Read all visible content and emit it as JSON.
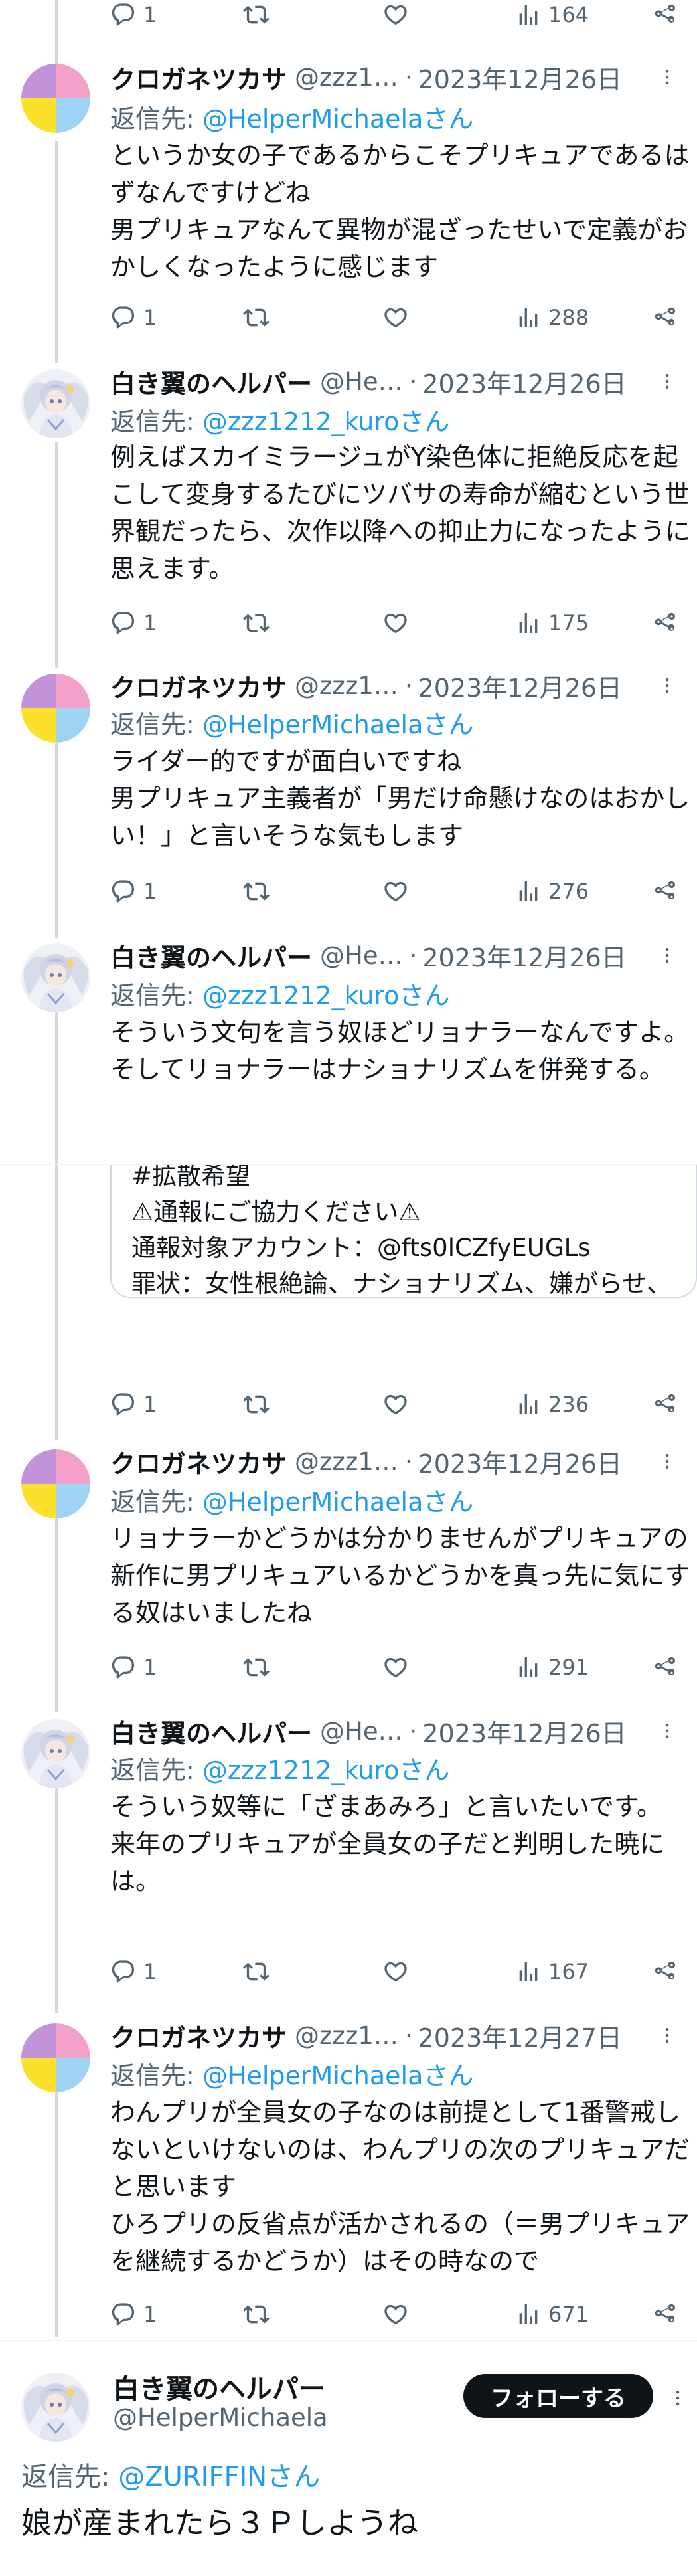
{
  "icons": {
    "reply": "reply-icon",
    "retweet": "retweet-icon",
    "like": "heart-icon",
    "views": "views-icon",
    "share": "share-icon",
    "more": "more-icon"
  },
  "colors": {
    "link": "#1d9bf0",
    "secondary": "#536471",
    "text": "#0f1419",
    "thread_line": "#cfd9de",
    "follow_button": "#0f1419"
  },
  "top_actions": {
    "reply_count": "1",
    "retweet_count": "",
    "like_count": "",
    "view_count": "164"
  },
  "tweets": [
    {
      "name": "クロガネツカサ",
      "handle": "@zzz1…",
      "dot": "·",
      "date": "2023年12月26日",
      "reply_prefix": "返信先:",
      "reply_target": "@HelperMichaelaさん",
      "text": "というか女の子であるからこそプリキュアであるはずなんですけどね\n男プリキュアなんて異物が混ざったせいで定義がおかしくなったように感じます",
      "reply_count": "1",
      "view_count": "288"
    },
    {
      "name": "白き翼のヘルパー",
      "handle": "@He…",
      "dot": "·",
      "date": "2023年12月26日",
      "reply_prefix": "返信先:",
      "reply_target": "@zzz1212_kuroさん",
      "text": "例えばスカイミラージュがY染色体に拒絶反応を起こして変身するたびにツバサの寿命が縮むという世界観だったら、次作以降への抑止力になったように思えます。",
      "reply_count": "1",
      "view_count": "175"
    },
    {
      "name": "クロガネツカサ",
      "handle": "@zzz1…",
      "dot": "·",
      "date": "2023年12月26日",
      "reply_prefix": "返信先:",
      "reply_target": "@HelperMichaelaさん",
      "text": "ライダー的ですが面白いですね\n男プリキュア主義者が「男だけ命懸けなのはおかしい！」と言いそうな気もします",
      "reply_count": "1",
      "view_count": "276"
    },
    {
      "name": "白き翼のヘルパー",
      "handle": "@He…",
      "dot": "·",
      "date": "2023年12月26日",
      "reply_prefix": "返信先:",
      "reply_target": "@zzz1212_kuroさん",
      "text": "そういう文句を言う奴ほどリョナラーなんですよ。\nそしてリョナラーはナショナリズムを併発する。",
      "card_text": "#拡散希望\n⚠通報にご協力ください⚠\n通報対象アカウント：@fts0lCZfyEUGLs\n罪状：女性根絶論、ナショナリズム、嫌がらせ、マーダー教唆、マーダー願望、女…",
      "reply_count": "1",
      "view_count": "236"
    },
    {
      "name": "クロガネツカサ",
      "handle": "@zzz1…",
      "dot": "·",
      "date": "2023年12月26日",
      "reply_prefix": "返信先:",
      "reply_target": "@HelperMichaelaさん",
      "text": "リョナラーかどうかは分かりませんがプリキュアの新作に男プリキュアいるかどうかを真っ先に気にする奴はいましたね",
      "reply_count": "1",
      "view_count": "291"
    },
    {
      "name": "白き翼のヘルパー",
      "handle": "@He…",
      "dot": "·",
      "date": "2023年12月26日",
      "reply_prefix": "返信先:",
      "reply_target": "@zzz1212_kuroさん",
      "text": "そういう奴等に「ざまあみろ」と言いたいです。\n来年のプリキュアが全員女の子だと判明した暁には。",
      "reply_count": "1",
      "view_count": "167"
    },
    {
      "name": "クロガネツカサ",
      "handle": "@zzz1…",
      "dot": "·",
      "date": "2023年12月27日",
      "reply_prefix": "返信先:",
      "reply_target": "@HelperMichaelaさん",
      "text": "わんプリが全員女の子なのは前提として1番警戒しないといけないのは、わんプリの次のプリキュアだと思います\nひろプリの反省点が活かされるの（＝男プリキュアを継続するかどうか）はその時なので",
      "reply_count": "1",
      "view_count": "671"
    }
  ],
  "main_tweet": {
    "name": "白き翼のヘルパー",
    "handle": "@HelperMichaela",
    "follow_label": "フォローする",
    "reply_prefix": "返信先:",
    "reply_target": "@ZURIFFINさん",
    "text": "娘が産まれたら３Ｐしようね"
  }
}
